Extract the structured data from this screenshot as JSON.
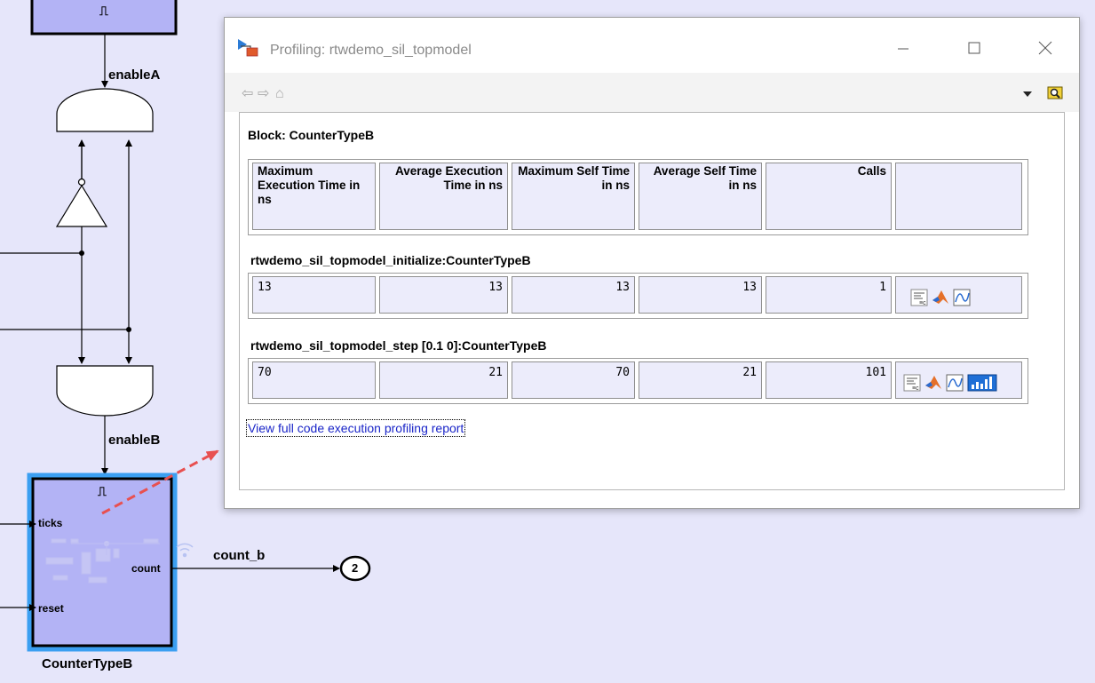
{
  "model": {
    "top_block_symbol": "⎍",
    "signal_enableA": "enableA",
    "signal_enableB": "enableB",
    "counter": {
      "symbol": "⎍",
      "port_ticks": "ticks",
      "port_reset": "reset",
      "port_count": "count",
      "name": "CounterTypeB"
    },
    "output_signal": "count_b",
    "outport_number": "2"
  },
  "window": {
    "title": "Profiling: rtwdemo_sil_topmodel",
    "controls": [
      "minimize-icon",
      "maximize-icon",
      "close-icon"
    ],
    "nav": {
      "back": "⇦",
      "forward": "⇨",
      "home": "⌂"
    }
  },
  "report": {
    "block_title": "Block: CounterTypeB",
    "headers": [
      "Maximum Execution Time in ns",
      "Average Execution Time in ns",
      "Maximum Self Time in ns",
      "Average Self Time in ns",
      "Calls",
      ""
    ],
    "rows": [
      {
        "label": "rtwdemo_sil_topmodel_initialize:CounterTypeB",
        "values": [
          "13",
          "13",
          "13",
          "13",
          "1"
        ],
        "icons": [
          "code-icon",
          "matlab-icon",
          "plot-icon"
        ]
      },
      {
        "label": "rtwdemo_sil_topmodel_step [0.1 0]:CounterTypeB",
        "values": [
          "70",
          "21",
          "70",
          "21",
          "101"
        ],
        "icons": [
          "code-icon",
          "matlab-icon",
          "plot-icon",
          "bar-chart-icon"
        ]
      }
    ],
    "link": "View full code execution profiling report"
  },
  "colors": {
    "canvas": "#e6e6fa",
    "block_fill": "#b3b3f5",
    "highlight": "#3b9ff1",
    "link": "#1a25c8",
    "arrow": "#e85050"
  }
}
